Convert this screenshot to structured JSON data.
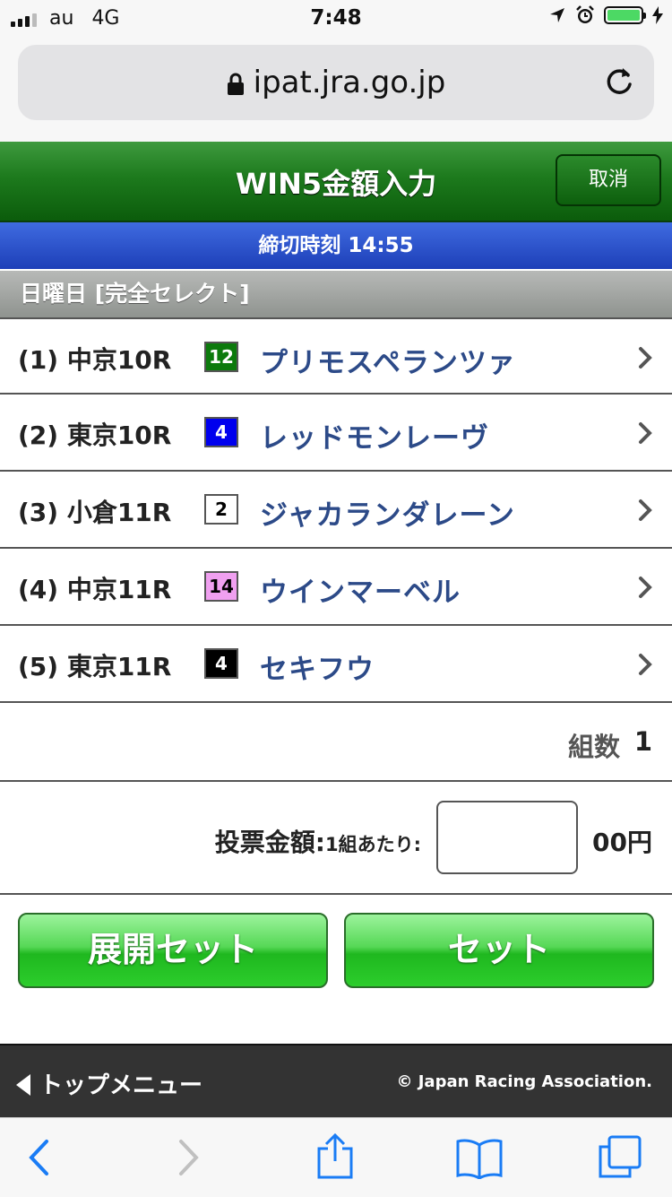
{
  "status_bar": {
    "carrier": "au",
    "network": "4G",
    "time": "7:48"
  },
  "browser": {
    "url": "ipat.jra.go.jp"
  },
  "header": {
    "title": "WIN5金額入力",
    "cancel_label": "取消"
  },
  "deadline": "締切時刻 14:55",
  "day_header": "日曜日 [完全セレクト]",
  "races": [
    {
      "label": "(1) 中京10R",
      "number": "12",
      "horse": "プリモスペランツァ",
      "num_bg": "#0c7a0c",
      "num_fg": "#ffffff"
    },
    {
      "label": "(2) 東京10R",
      "number": "4",
      "horse": "レッドモンレーヴ",
      "num_bg": "#0000ee",
      "num_fg": "#ffffff"
    },
    {
      "label": "(3) 小倉11R",
      "number": "2",
      "horse": "ジャカランダレーン",
      "num_bg": "#ffffff",
      "num_fg": "#000000"
    },
    {
      "label": "(4) 中京11R",
      "number": "14",
      "horse": "ウインマーベル",
      "num_bg": "#f0a0f0",
      "num_fg": "#000000"
    },
    {
      "label": "(5) 東京11R",
      "number": "4",
      "horse": "セキフウ",
      "num_bg": "#000000",
      "num_fg": "#ffffff"
    }
  ],
  "combinations": {
    "label": "組数",
    "value": "1"
  },
  "amount": {
    "label": "投票金額:",
    "sublabel": "1組あたり:",
    "value": "",
    "unit": "00円"
  },
  "buttons": {
    "expand_set": "展開セット",
    "set": "セット"
  },
  "footer": {
    "top_menu": "トップメニュー",
    "copyright": "© Japan Racing Association."
  },
  "colors": {
    "header_green": "#1d7a1d",
    "deadline_blue": "#2a4fcf",
    "button_green": "#3cc83c",
    "horse_text": "#2c4a88"
  }
}
